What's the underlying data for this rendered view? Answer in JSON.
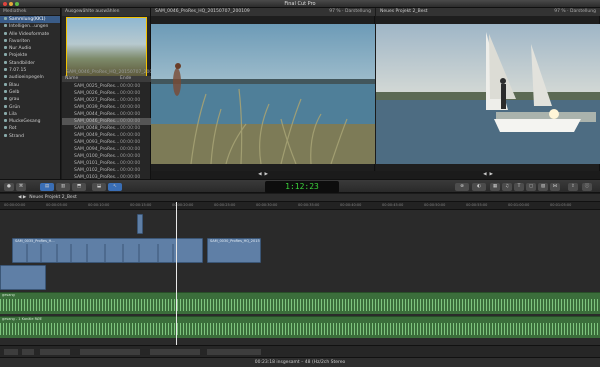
{
  "window": {
    "title": "Final Cut Pro"
  },
  "library": {
    "header": "Mediathek",
    "items": [
      {
        "label": "Sammlung(KK1)",
        "selected": true
      },
      {
        "label": "Intelligen...ungen",
        "selected": false
      },
      {
        "label": "Alle Videoformate",
        "selected": false
      },
      {
        "label": "Favoriten",
        "selected": false
      },
      {
        "label": "Nur Audio",
        "selected": false
      },
      {
        "label": "Projekte",
        "selected": false
      },
      {
        "label": "Standbilder",
        "selected": false
      },
      {
        "label": "7.07.15",
        "selected": false
      },
      {
        "label": "audioeinpegeln",
        "selected": false
      },
      {
        "label": "Blau",
        "selected": false
      },
      {
        "label": "Gelb",
        "selected": false
      },
      {
        "label": "grau",
        "selected": false
      },
      {
        "label": "Grün",
        "selected": false
      },
      {
        "label": "Lila",
        "selected": false
      },
      {
        "label": "MuckeGesang",
        "selected": false
      },
      {
        "label": "Rot",
        "selected": false
      },
      {
        "label": "Strand",
        "selected": false
      }
    ]
  },
  "browser": {
    "header": "Ausgewählte auswählen",
    "thumb_caption": "SAM_0046_ProRes_HQ_20150707_200109",
    "col_name": "Name",
    "col_end": "Ende",
    "files": [
      {
        "name": "SAM_0025_ProRes...",
        "dur": "00:00:00"
      },
      {
        "name": "SAM_0026_ProRes...",
        "dur": "00:00:00"
      },
      {
        "name": "SAM_0027_ProRes...",
        "dur": "00:00:00"
      },
      {
        "name": "SAM_0039_ProRes...",
        "dur": "00:00:00"
      },
      {
        "name": "SAM_0044_ProRes...",
        "dur": "00:00:00"
      },
      {
        "name": "SAM_0046_ProRes...",
        "dur": "00:00:00",
        "selected": true
      },
      {
        "name": "SAM_0048_ProRes...",
        "dur": "00:00:00"
      },
      {
        "name": "SAM_0049_ProRes...",
        "dur": "00:00:00"
      },
      {
        "name": "SAM_0093_ProRes...",
        "dur": "00:00:00"
      },
      {
        "name": "SAM_0094_ProRes...",
        "dur": "00:00:00"
      },
      {
        "name": "SAM_0100_ProRes...",
        "dur": "00:00:00"
      },
      {
        "name": "SAM_0101_ProRes...",
        "dur": "00:00:00"
      },
      {
        "name": "SAM_0102_ProRes...",
        "dur": "00:00:00"
      },
      {
        "name": "SAM_0103_ProRes...",
        "dur": "00:00:00"
      }
    ],
    "footer": "1 von 78 ausgewählt, 04:11"
  },
  "viewer_left": {
    "title": "SAM_0046_ProRes_HQ_20150707_200109",
    "zoom": "97 %",
    "display": "Darstellung"
  },
  "viewer_right": {
    "title": "Neues Projekt 2_Best",
    "zoom": "97 %",
    "display": "Darstellung"
  },
  "toolbar": {
    "timecode": "1:12:23"
  },
  "timeline": {
    "project": "Neues Projekt 2_Best",
    "ruler": [
      "00:00:00:00",
      "00:00:05:00",
      "00:00:10:00",
      "00:00:15:00",
      "00:00:20:00",
      "00:00:25:00",
      "00:00:30:00",
      "00:00:35:00",
      "00:00:40:00",
      "00:00:45:00",
      "00:00:50:00",
      "00:00:55:00",
      "00:01:00:00",
      "00:01:05:00"
    ],
    "clip_main_label": "SAM_0035_ProRes_H...",
    "clip_right_label": "SAM_0030_ProRes_HQ_2015070",
    "audio1": "gesang",
    "audio2": "gesang - 1 Kanäle RØE"
  },
  "status": {
    "text": "00:23:18 insgesamt – 48 (Hz/2ch Stereo"
  }
}
